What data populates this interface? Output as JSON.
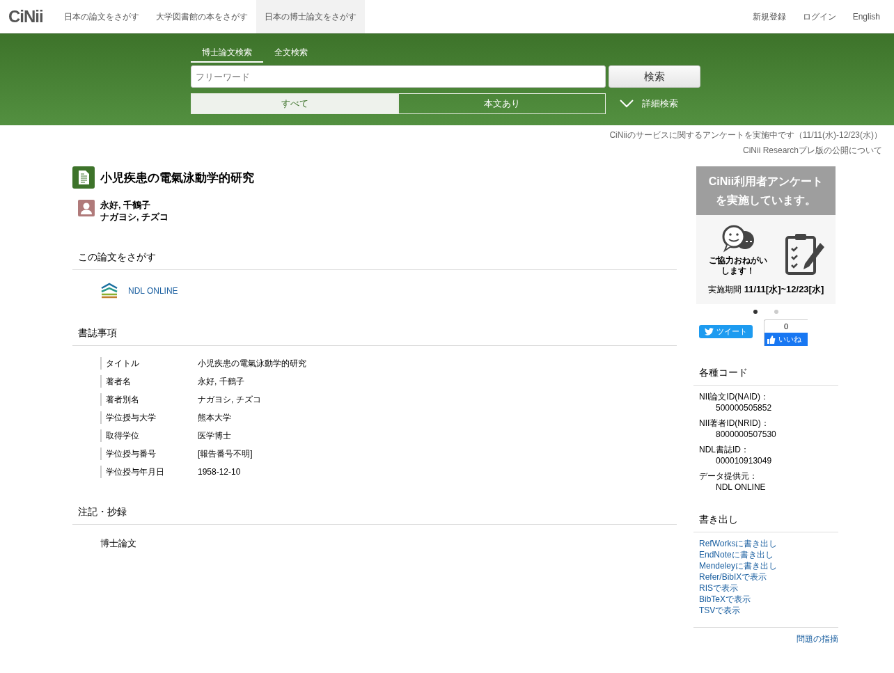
{
  "header": {
    "logo": "CiNii",
    "nav": [
      {
        "label": "日本の論文をさがす",
        "selected": false
      },
      {
        "label": "大学図書館の本をさがす",
        "selected": false
      },
      {
        "label": "日本の博士論文をさがす",
        "selected": true
      }
    ],
    "links": [
      "新規登録",
      "ログイン",
      "English"
    ]
  },
  "search": {
    "tabs": [
      {
        "label": "博士論文検索",
        "selected": true
      },
      {
        "label": "全文検索",
        "selected": false
      }
    ],
    "placeholder": "フリーワード",
    "button": "検索",
    "filters": [
      {
        "label": "すべて",
        "selected": true
      },
      {
        "label": "本文あり",
        "selected": false
      }
    ],
    "advanced": "詳細検索"
  },
  "notices": [
    "CiNiiのサービスに関するアンケートを実施中です（11/11(水)-12/23(水)）",
    "CiNii Researchプレ版の公開について"
  ],
  "article": {
    "title": "小児疾患の電氣泳動学的研究",
    "author": "永好, 千鶴子",
    "author_kana": "ナガヨシ, チズコ"
  },
  "find": {
    "heading": "この論文をさがす",
    "links": [
      "NDL ONLINE"
    ]
  },
  "biblio": {
    "heading": "書誌事項",
    "rows": [
      {
        "label": "タイトル",
        "value": "小児疾患の電氣泳動学的研究"
      },
      {
        "label": "著者名",
        "value": "永好, 千鶴子"
      },
      {
        "label": "著者別名",
        "value": "ナガヨシ, チズコ"
      },
      {
        "label": "学位授与大学",
        "value": "熊本大学"
      },
      {
        "label": "取得学位",
        "value": "医学博士"
      },
      {
        "label": "学位授与番号",
        "value": "[報告番号不明]"
      },
      {
        "label": "学位授与年月日",
        "value": "1958-12-10"
      }
    ]
  },
  "notes": {
    "heading": "注記・抄録",
    "text": "博士論文"
  },
  "banner": {
    "title": "CiNii利用者アンケートを実施しています。",
    "caption": "ご協力おねがいします！",
    "period_label": "実施期間",
    "period": "11/11[水]~12/23[水]",
    "dots": [
      {
        "selected": true
      },
      {
        "selected": false
      }
    ]
  },
  "social": {
    "tweet": "ツイート",
    "like_count": "0",
    "like": "いいね"
  },
  "codes": {
    "heading": "各種コード",
    "items": [
      {
        "label": "NII論文ID(NAID)：",
        "value": "500000505852"
      },
      {
        "label": "NII著者ID(NRID)：",
        "value": "8000000507530"
      },
      {
        "label": "NDL書誌ID：",
        "value": "000010913049"
      },
      {
        "label": "データ提供元：",
        "value": "NDL ONLINE"
      }
    ]
  },
  "export": {
    "heading": "書き出し",
    "links": [
      "RefWorksに書き出し",
      "EndNoteに書き出し",
      "Mendeleyに書き出し",
      "Refer/BibIXで表示",
      "RISで表示",
      "BibTeXで表示",
      "TSVで表示"
    ]
  },
  "report": "問題の指摘"
}
